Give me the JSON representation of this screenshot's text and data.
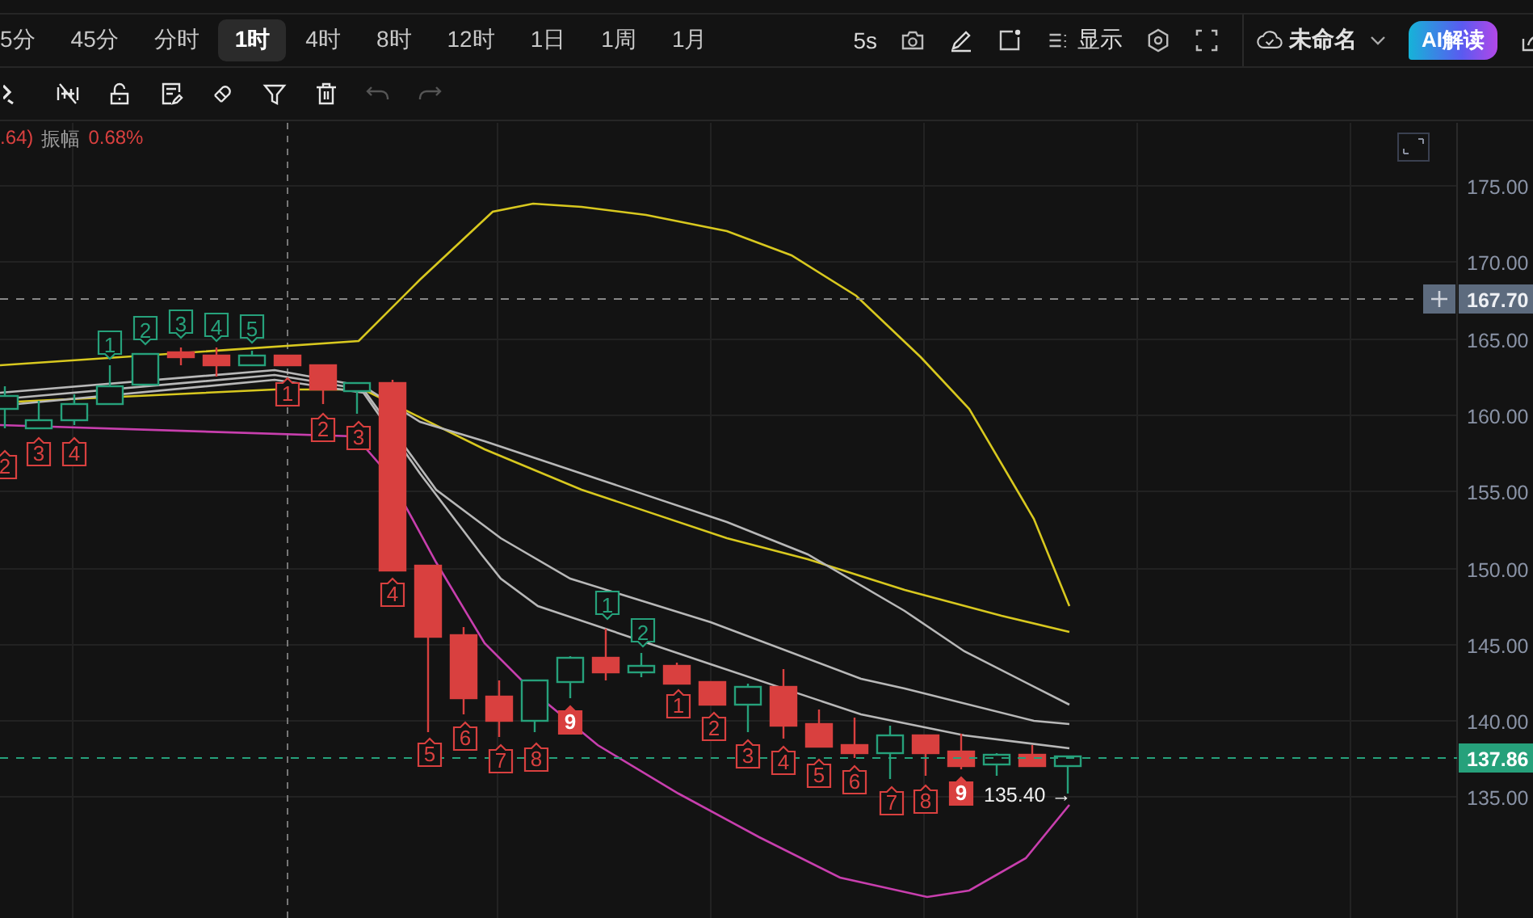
{
  "timeframes": [
    {
      "label": "5分",
      "selected": false
    },
    {
      "label": "45分",
      "selected": false
    },
    {
      "label": "分时",
      "selected": false
    },
    {
      "label": "1时",
      "selected": true
    },
    {
      "label": "4时",
      "selected": false
    },
    {
      "label": "8时",
      "selected": false
    },
    {
      "label": "12时",
      "selected": false
    },
    {
      "label": "1日",
      "selected": false
    },
    {
      "label": "1周",
      "selected": false
    },
    {
      "label": "1月",
      "selected": false
    }
  ],
  "toolbar_right": {
    "refresh": "5s",
    "display": "显示",
    "layout_name": "未命名",
    "ai_button": "AI解读"
  },
  "drawing_tools": [
    {
      "kind": "partial",
      "disabled": false
    },
    {
      "kind": "hide",
      "disabled": false
    },
    {
      "kind": "lock",
      "disabled": false
    },
    {
      "kind": "note",
      "disabled": false
    },
    {
      "kind": "magnet",
      "disabled": false
    },
    {
      "kind": "filter",
      "disabled": false
    },
    {
      "kind": "trash",
      "disabled": false
    },
    {
      "kind": "undo",
      "disabled": true
    },
    {
      "kind": "redo",
      "disabled": true
    }
  ],
  "info": {
    "value": ".64)",
    "amplitude_label": "振幅",
    "amplitude": "0.68%"
  },
  "price_axis": {
    "ticks": [
      "175.00",
      "170.00",
      "165.00",
      "160.00",
      "155.00",
      "150.00",
      "145.00",
      "140.00",
      "135.00"
    ]
  },
  "price_tags": [
    {
      "kind": "crosshair",
      "label": "167.70"
    },
    {
      "kind": "last",
      "label": "137.86"
    }
  ],
  "low_label": "135.40 →",
  "td_markers": [
    {
      "label": "2",
      "kind": "sell"
    },
    {
      "label": "3",
      "kind": "sell"
    },
    {
      "label": "4",
      "kind": "sell"
    },
    {
      "label": "1",
      "kind": "buy"
    },
    {
      "label": "2",
      "kind": "buy"
    },
    {
      "label": "3",
      "kind": "buy"
    },
    {
      "label": "4",
      "kind": "buy"
    },
    {
      "label": "5",
      "kind": "buy"
    },
    {
      "label": "1",
      "kind": "sell"
    },
    {
      "label": "2",
      "kind": "sell"
    },
    {
      "label": "3",
      "kind": "sell"
    },
    {
      "label": "4",
      "kind": "sell"
    },
    {
      "label": "5",
      "kind": "sell"
    },
    {
      "label": "6",
      "kind": "sell"
    },
    {
      "label": "7",
      "kind": "sell"
    },
    {
      "label": "8",
      "kind": "sell"
    },
    {
      "label": "9",
      "kind": "sell_final"
    },
    {
      "label": "1",
      "kind": "buy"
    },
    {
      "label": "2",
      "kind": "buy"
    },
    {
      "label": "1",
      "kind": "sell"
    },
    {
      "label": "2",
      "kind": "sell"
    },
    {
      "label": "3",
      "kind": "sell"
    },
    {
      "label": "4",
      "kind": "sell"
    },
    {
      "label": "5",
      "kind": "sell"
    },
    {
      "label": "6",
      "kind": "sell"
    },
    {
      "label": "7",
      "kind": "sell"
    },
    {
      "label": "8",
      "kind": "sell"
    },
    {
      "label": "9",
      "kind": "sell_final"
    }
  ]
}
